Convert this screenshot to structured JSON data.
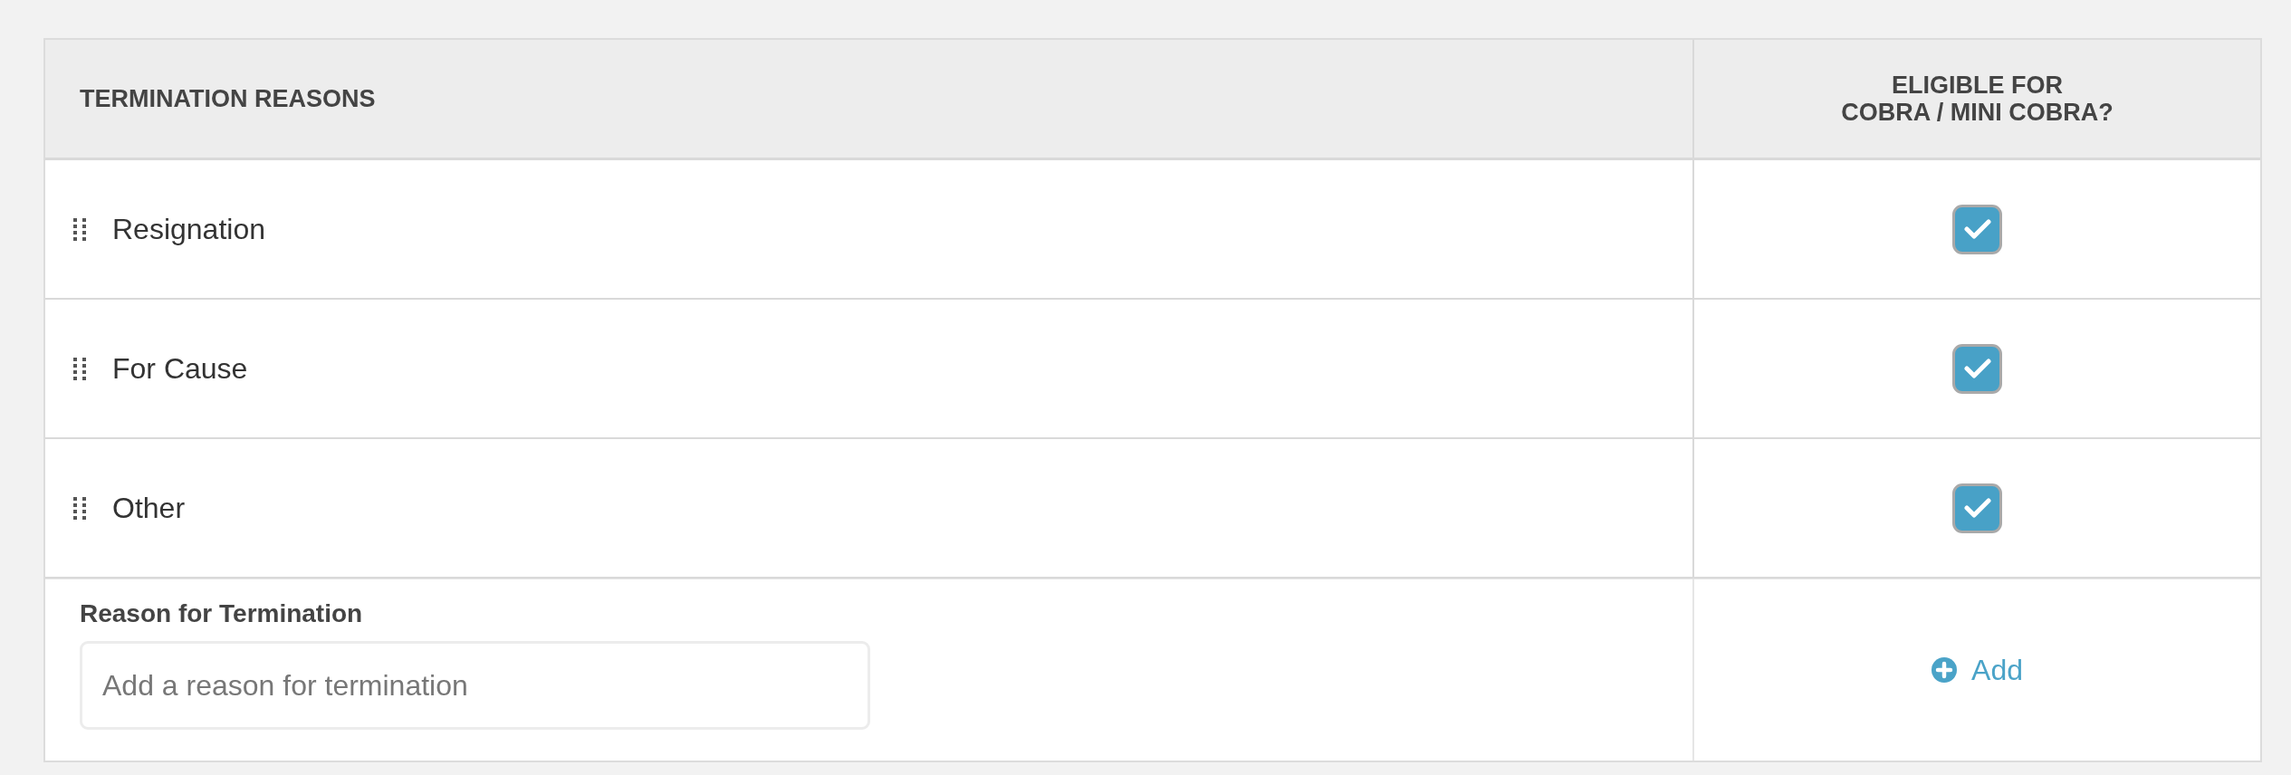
{
  "table": {
    "columns": [
      {
        "label": "TERMINATION REASONS"
      },
      {
        "label": "ELIGIBLE FOR\nCOBRA / MINI COBRA?"
      }
    ],
    "rows": [
      {
        "reason": "Resignation",
        "checked": true
      },
      {
        "reason": "For Cause",
        "checked": true
      },
      {
        "reason": "Other",
        "checked": true
      }
    ]
  },
  "new_reason": {
    "label": "Reason for Termination",
    "placeholder": "Add a reason for termination",
    "add_button": "Add"
  }
}
